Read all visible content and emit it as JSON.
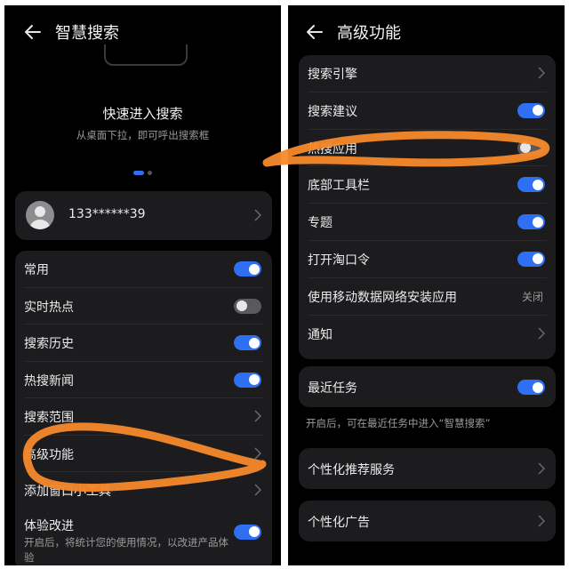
{
  "left": {
    "header": {
      "title": "智慧搜索",
      "back_icon": "back-arrow-icon"
    },
    "hero": {
      "title": "快速进入搜索",
      "subtitle": "从桌面下拉，即可呼出搜索框"
    },
    "account": {
      "phone": "133******39"
    },
    "settings": [
      {
        "label": "常用",
        "control": "toggle",
        "on": true
      },
      {
        "label": "实时热点",
        "control": "toggle",
        "on": false
      },
      {
        "label": "搜索历史",
        "control": "toggle",
        "on": true
      },
      {
        "label": "热搜新闻",
        "control": "toggle",
        "on": true
      },
      {
        "label": "搜索范围",
        "control": "chevron"
      },
      {
        "label": "高级功能",
        "control": "chevron"
      },
      {
        "label": "添加窗口小工具",
        "control": "chevron"
      }
    ],
    "experience": {
      "label": "体验改进",
      "desc": "开启后，将统计您的使用情况，以改进产品体验",
      "on": true
    }
  },
  "right": {
    "header": {
      "title": "高级功能",
      "back_icon": "back-arrow-icon"
    },
    "settings": [
      {
        "label": "搜索引擎",
        "control": "chevron"
      },
      {
        "label": "搜索建议",
        "control": "toggle",
        "on": true
      },
      {
        "label": "热搜应用",
        "control": "toggle",
        "on": false
      },
      {
        "label": "底部工具栏",
        "control": "toggle",
        "on": true
      },
      {
        "label": "专题",
        "control": "toggle",
        "on": true
      },
      {
        "label": "打开淘口令",
        "control": "toggle",
        "on": true
      },
      {
        "label": "使用移动数据网络安装应用",
        "control": "value",
        "value": "关闭"
      },
      {
        "label": "通知",
        "control": "chevron"
      }
    ],
    "recent": {
      "label": "最近任务",
      "on": true,
      "note": "开启后，可在最近任务中进入“智慧搜索”"
    },
    "personal_service": {
      "label": "个性化推荐服务"
    },
    "personal_ads": {
      "label": "个性化广告"
    }
  },
  "colors": {
    "accent": "#2f6ff2",
    "card": "#1c1c1e",
    "background": "#000000",
    "annotation": "#f5892a"
  }
}
